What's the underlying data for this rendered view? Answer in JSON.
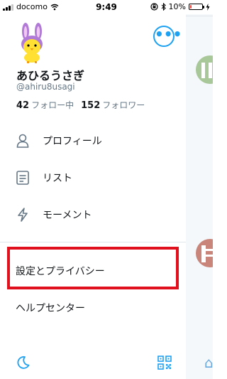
{
  "status_bar": {
    "carrier": "docomo",
    "time": "9:49",
    "battery_text": "10%",
    "battery_level": 0.1,
    "battery_color": "#ff3b30"
  },
  "profile": {
    "display_name": "あひるうさぎ",
    "handle": "@ahiru8usagi",
    "following_count": "42",
    "following_label": "フォロー中",
    "followers_count": "152",
    "followers_label": "フォロワー",
    "more_icon": "more-dots-icon",
    "more_label": "•••"
  },
  "menu": {
    "items": [
      {
        "label": "プロフィール",
        "icon": "person-icon"
      },
      {
        "label": "リスト",
        "icon": "list-icon"
      },
      {
        "label": "モーメント",
        "icon": "lightning-icon"
      }
    ],
    "settings_label": "設定とプライバシー",
    "help_label": "ヘルプセンター"
  },
  "footer": {
    "night_mode_icon": "moon-icon",
    "qr_icon": "qr-code-icon"
  },
  "colors": {
    "accent": "#1da1f2",
    "highlight": "#e0101d"
  }
}
